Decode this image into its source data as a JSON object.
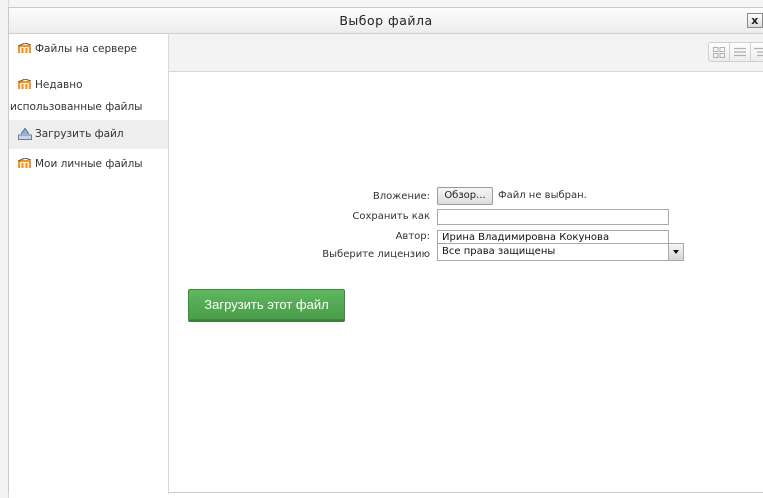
{
  "dialog": {
    "title": "Выбор файла",
    "close_label": "x"
  },
  "sidebar": {
    "items": [
      {
        "label": "Файлы на сервере",
        "icon": "moodle-icon",
        "active": false
      },
      {
        "label_line1": "Недавно",
        "label_line2": "использованные файлы",
        "icon": "moodle-icon",
        "active": false
      },
      {
        "label": "Загрузить файл",
        "icon": "upload-icon",
        "active": true
      },
      {
        "label": "Мои личные файлы",
        "icon": "moodle-icon",
        "active": false
      }
    ]
  },
  "toolbar": {
    "view_buttons": [
      "icons-view-icon",
      "list-view-icon",
      "tree-view-icon"
    ]
  },
  "form": {
    "attachment_label": "Вложение:",
    "browse_label": "Обзор...",
    "no_file_text": "Файл не выбран.",
    "save_as_label": "Сохранить как",
    "save_as_value": "",
    "author_label": "Автор:",
    "author_value": "Ирина Владимировна Кокунова",
    "license_label": "Выберите лицензию",
    "license_value": "Все права защищены",
    "upload_button": "Загрузить этот файл"
  },
  "colors": {
    "upload_button": "#55a955",
    "moodle_orange": "#f7931e"
  }
}
